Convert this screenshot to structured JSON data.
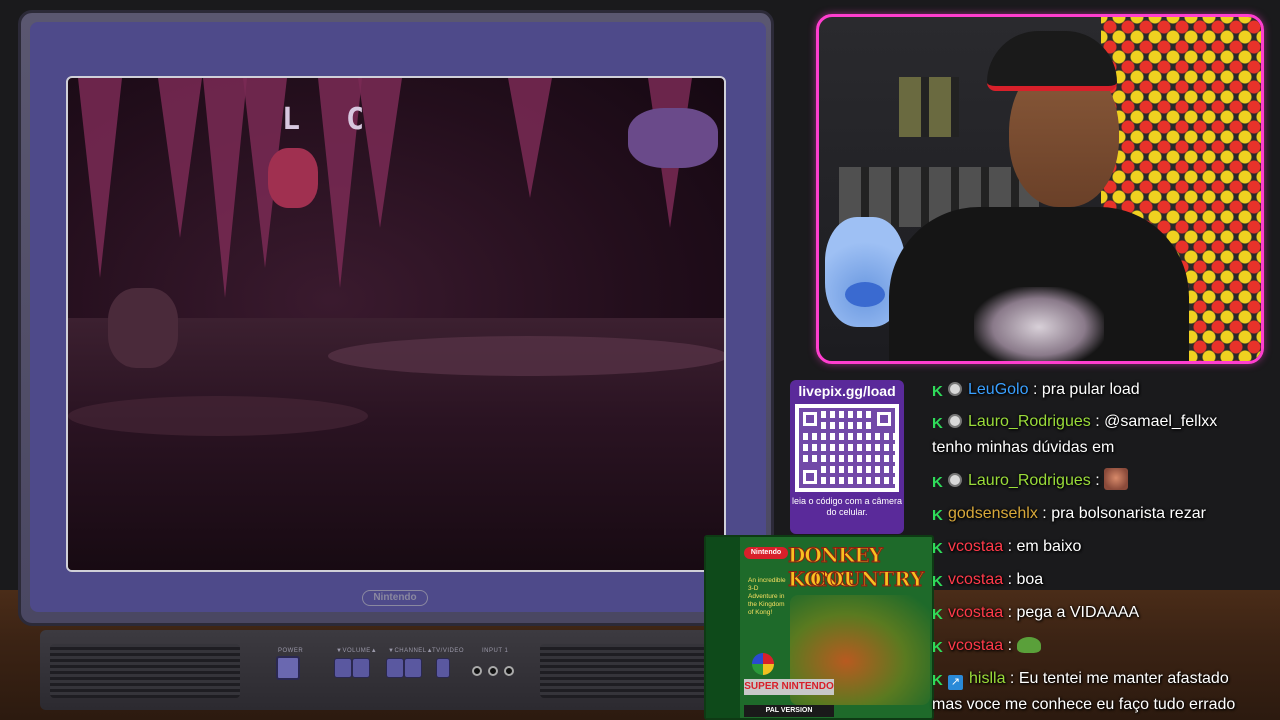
{
  "tv": {
    "brand": "Nintendo",
    "hud_letters": [
      "L",
      "C"
    ],
    "controls": {
      "power_label": "POWER",
      "volume_label": "▼VOLUME▲",
      "channel_label": "▼CHANNEL▲",
      "tv_video_label": "TV/VIDEO",
      "input_label": "INPUT 1"
    }
  },
  "qr": {
    "url": "livepix.gg/load",
    "caption": "leia o código com a câmera do celular."
  },
  "gamebox": {
    "publisher_logo": "Nintendo",
    "title_line1": "DONKEY KONG",
    "title_line2": "COUNTRY",
    "blurb": "An incredible 3-D Adventure in the Kingdom of Kong!",
    "console": "SUPER NINTENDO",
    "region": "PAL VERSION"
  },
  "chat": {
    "messages": [
      {
        "user": "LeuGolo",
        "color": "#3aa0ff",
        "badges": [
          "k",
          "circle"
        ],
        "text": ": pra pular load",
        "emote": ""
      },
      {
        "user": "Lauro_Rodrigues",
        "color": "#9adc3a",
        "badges": [
          "k",
          "circle"
        ],
        "text": ": @samael_fellxx",
        "cont": "tenho minhas dúvidas em",
        "emote": ""
      },
      {
        "user": "Lauro_Rodrigues",
        "color": "#9adc3a",
        "badges": [
          "k",
          "circle"
        ],
        "text": ":",
        "emote": "face"
      },
      {
        "user": "godsensehlx",
        "color": "#d8a83a",
        "badges": [
          "k"
        ],
        "text": ": pra bolsonarista rezar",
        "emote": ""
      },
      {
        "user": "vcostaa",
        "color": "#ff3a4a",
        "badges": [
          "k"
        ],
        "text": ": em baixo",
        "emote": ""
      },
      {
        "user": "vcostaa",
        "color": "#ff3a4a",
        "badges": [
          "k"
        ],
        "text": ": boa",
        "emote": ""
      },
      {
        "user": "vcostaa",
        "color": "#ff3a4a",
        "badges": [
          "k"
        ],
        "text": ": pega a VIDAAAA",
        "emote": ""
      },
      {
        "user": "vcostaa",
        "color": "#ff3a4a",
        "badges": [
          "k"
        ],
        "text": ":",
        "emote": "frog"
      },
      {
        "user": "hislla",
        "color": "#9adc3a",
        "badges": [
          "k",
          "arrow"
        ],
        "text": ": Eu tentei me manter afastado",
        "cont": "mas voce me conhece eu faço tudo errado",
        "emote": ""
      }
    ]
  },
  "colors": {
    "cam_border": "#ff3ecf",
    "qr_panel": "#5a2a9a",
    "badge_k": "#2fdc5a"
  }
}
